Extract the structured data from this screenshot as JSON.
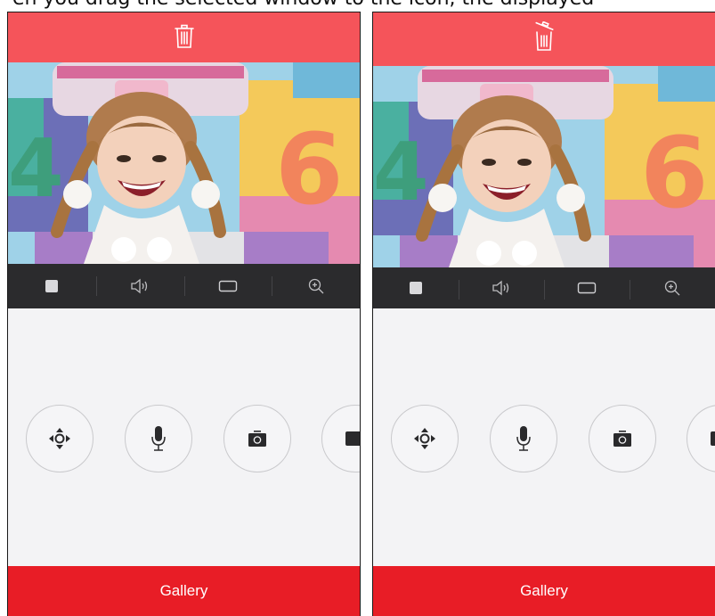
{
  "caption": {
    "text": "en you drag the selected window to the icon, the displayed"
  },
  "colors": {
    "topbar": "#f5545a",
    "toolbar": "#2b2b2d",
    "gallery_bar": "#e81d26",
    "background": "#f3f3f5"
  },
  "toolbar": {
    "icons": [
      "stop-square-icon",
      "speaker-icon",
      "aspect-ratio-icon",
      "zoom-in-icon"
    ]
  },
  "controls": {
    "icons": [
      "ptz-direction-icon",
      "microphone-icon",
      "camera-snapshot-icon",
      "record-icon"
    ]
  },
  "left": {
    "trash_state": "closed",
    "gallery_label": "Gallery"
  },
  "right": {
    "trash_state": "lid-open",
    "gallery_label": "Gallery"
  }
}
